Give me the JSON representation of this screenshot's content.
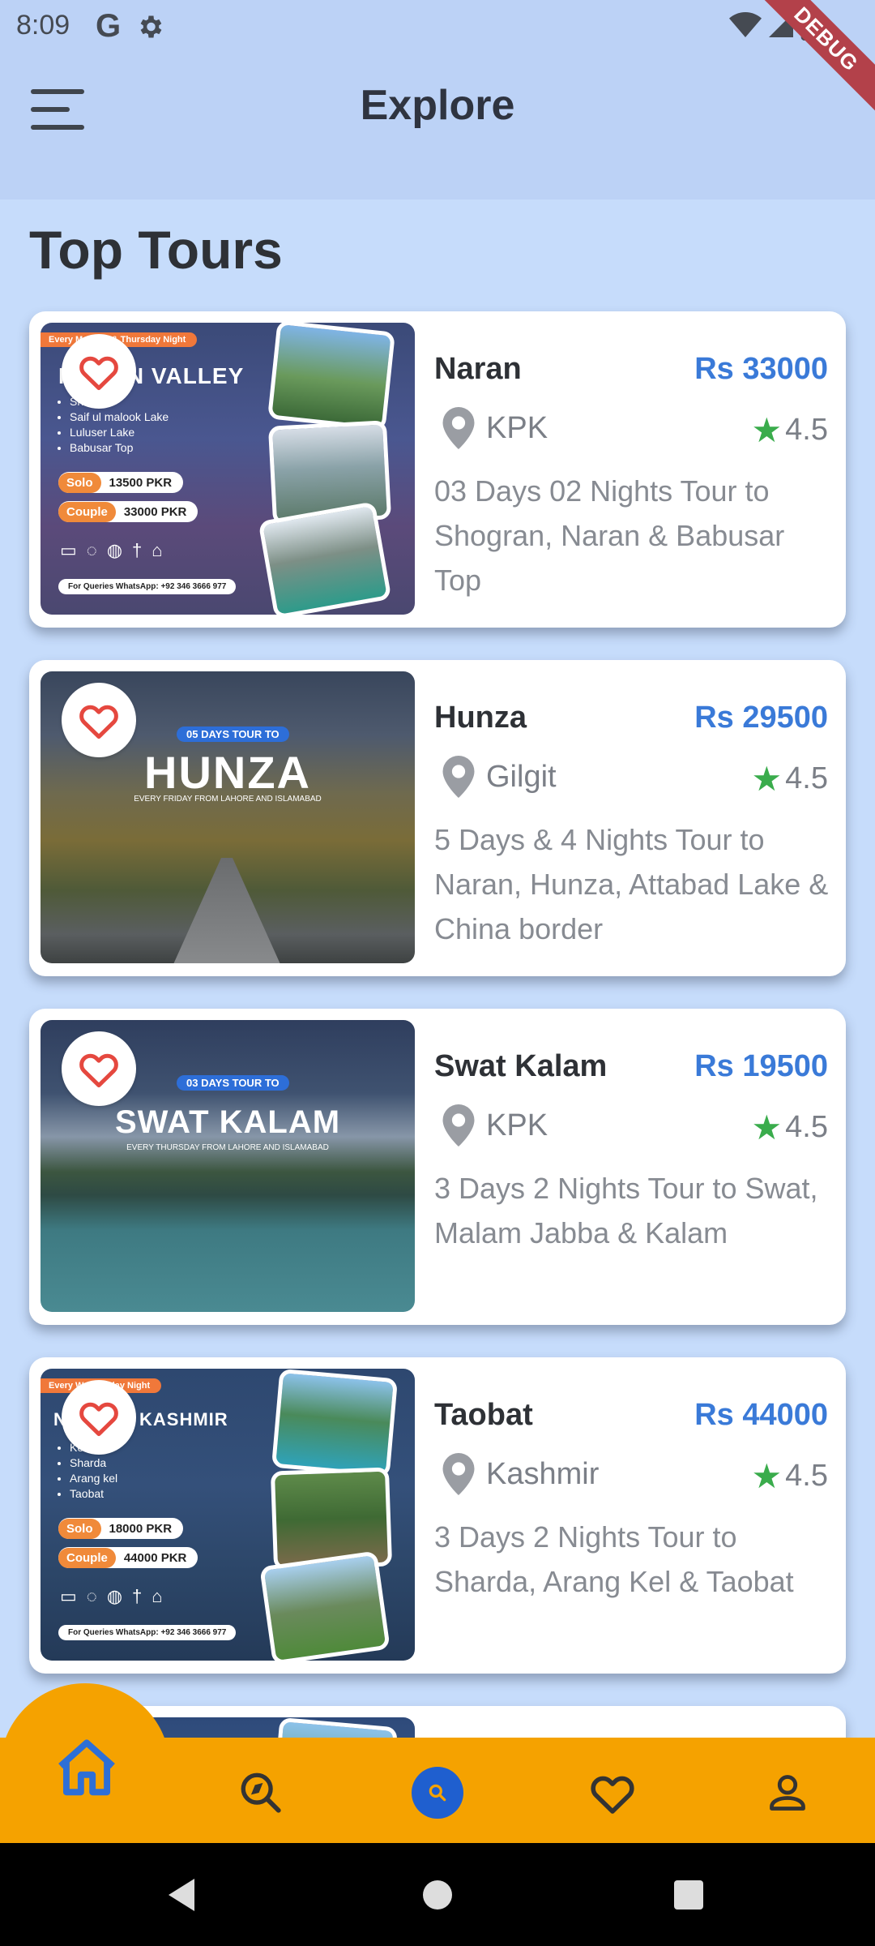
{
  "status": {
    "time": "8:09",
    "debug_label": "DEBUG"
  },
  "header": {
    "title": "Explore"
  },
  "section": {
    "title": "Top Tours"
  },
  "tours": [
    {
      "name": "Naran",
      "price": "Rs 33000",
      "location": "KPK",
      "rating": "4.5",
      "description": "03 Days 02 Nights Tour to Shogran, Naran & Babusar Top",
      "poster": {
        "banner": "Every Monday & Thursday Night",
        "title": "NARAN VALLEY",
        "spots": [
          "Shogran",
          "Saif ul malook Lake",
          "Luluser Lake",
          "Babusar Top"
        ],
        "solo_label": "Solo",
        "solo_price": "13500 PKR",
        "couple_label": "Couple",
        "couple_price": "33000 PKR",
        "contact": "For Queries WhatsApp: +92 346 3666 977"
      }
    },
    {
      "name": "Hunza",
      "price": "Rs 29500",
      "location": "Gilgit",
      "rating": "4.5",
      "description": "5 Days & 4 Nights Tour to Naran, Hunza, Attabad Lake & China border",
      "poster": {
        "tag": "05 DAYS TOUR TO",
        "title": "HUNZA",
        "subtitle": "EVERY FRIDAY FROM LAHORE AND ISLAMABAD"
      }
    },
    {
      "name": "Swat Kalam",
      "price": "Rs 19500",
      "location": "KPK",
      "rating": "4.5",
      "description": "3 Days 2 Nights Tour to Swat, Malam Jabba & Kalam",
      "poster": {
        "tag": "03 DAYS TOUR TO",
        "title": "SWAT KALAM",
        "subtitle": "EVERY THURSDAY FROM LAHORE AND ISLAMABAD"
      }
    },
    {
      "name": "Taobat",
      "price": "Rs 44000",
      "location": "Kashmir",
      "rating": "4.5",
      "description": "3 Days 2 Nights Tour to Sharda, Arang Kel & Taobat",
      "poster": {
        "banner": "Every Wednesday Night",
        "title": "NEELUM KASHMIR",
        "spots": [
          "Keran",
          "Sharda",
          "Arang kel",
          "Taobat"
        ],
        "solo_label": "Solo",
        "solo_price": "18000 PKR",
        "couple_label": "Couple",
        "couple_price": "44000 PKR",
        "contact": "For Queries WhatsApp: +92 346 3666 977"
      }
    }
  ],
  "nav": {
    "items": [
      {
        "icon": "home-icon",
        "active": true
      },
      {
        "icon": "explore-search-icon",
        "active": false
      },
      {
        "icon": "search-circle-icon",
        "active": false
      },
      {
        "icon": "heart-icon",
        "active": false
      },
      {
        "icon": "person-icon",
        "active": false
      }
    ]
  },
  "colors": {
    "appbar": "#bcd2f6",
    "background": "#c6dcfb",
    "price": "#3a7ad8",
    "nav": "#f5a200",
    "favorite": "#e5483f",
    "star": "#3aac4c"
  }
}
